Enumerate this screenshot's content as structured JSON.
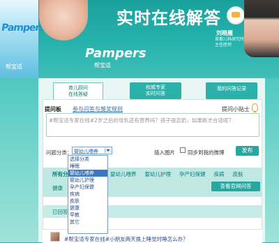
{
  "banner": {
    "title": "实时在线解答",
    "doctor_name": "刘晓雁",
    "doctor_title": "首都儿科研究所 主任医师",
    "brand_logo": "Pampers",
    "brand_cn": "帮宝适",
    "left_brand": "Pampers",
    "left_brand_cn": "帮宝适"
  },
  "tabs": [
    {
      "label": "育儿顾问\n在线答疑"
    },
    {
      "label": "权威专家\n实时问答"
    },
    {
      "label": "我的问答记录"
    }
  ],
  "ask": {
    "board_title": "提问板",
    "rules_link": "参与问答与獎奖规则",
    "tip_link": "提问小贴士",
    "question_placeholder": "#帮宝适专家在线#2岁之后的母乳还有营养吗？孩子很恋奶，如果断才合适呢？",
    "category_label": "问题分类：",
    "category_selected": "婴幼儿喂养",
    "insert_image": "插入图片",
    "sync_label": "同步到我的微博",
    "publish_label": "发布"
  },
  "category_options": [
    "选择分类",
    "睡眠",
    "婴幼儿喂养",
    "婴幼儿护理",
    "孕产妇保健",
    "疾病",
    "皮肤",
    "健康",
    "早教",
    "其它"
  ],
  "categories": {
    "heading": "所有分类",
    "links": [
      "婴幼儿喂养",
      "婴幼儿护理",
      "孕产妇保健",
      "疾病",
      "皮肤"
    ],
    "health": "健康",
    "view_all": "查看官网问答"
  },
  "resolved_label": "已回答",
  "feed": {
    "text": "#帮宝适专家在线#小朋友两天换上睡觉时睡怎么办？"
  }
}
